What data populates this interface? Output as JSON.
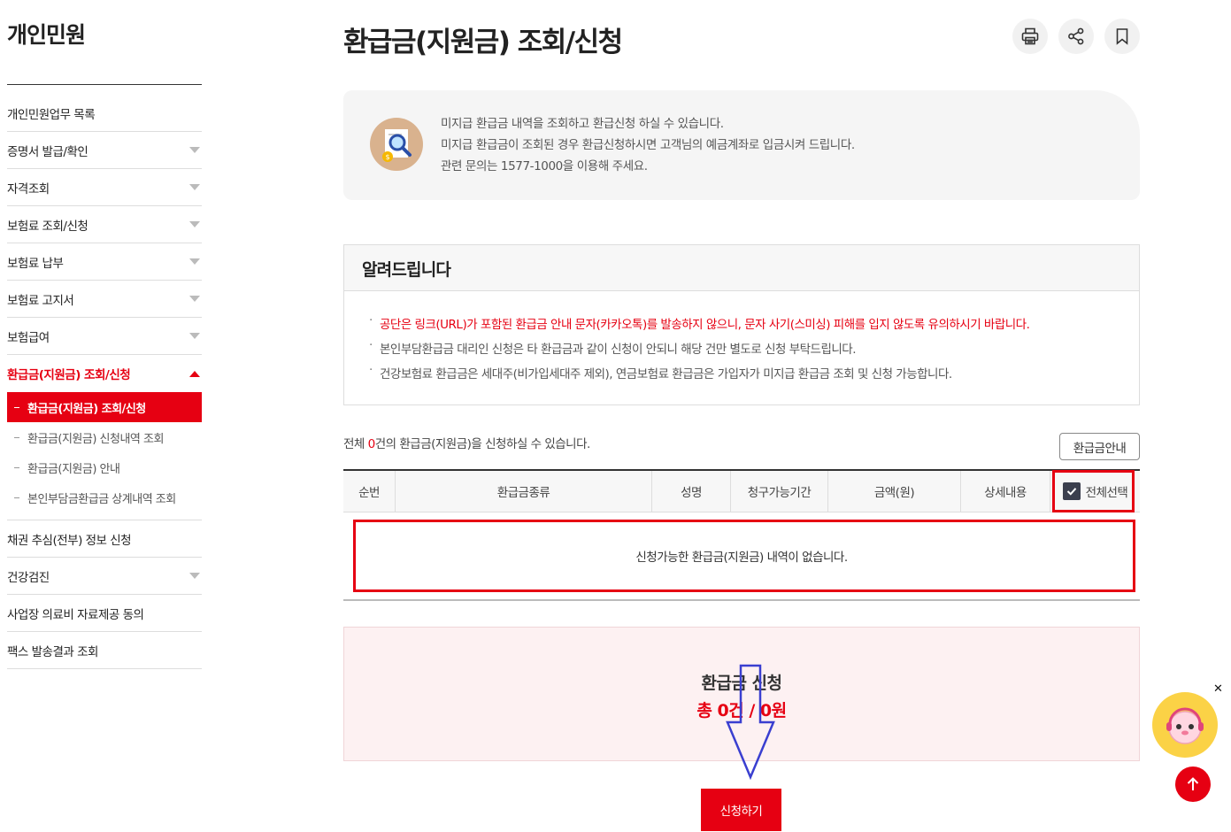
{
  "sidebar": {
    "title": "개인민원",
    "items": [
      {
        "label": "개인민원업무 목록",
        "arrow": false
      },
      {
        "label": "증명서 발급/확인",
        "arrow": true
      },
      {
        "label": "자격조회",
        "arrow": true
      },
      {
        "label": "보험료 조회/신청",
        "arrow": true
      },
      {
        "label": "보험료 납부",
        "arrow": true
      },
      {
        "label": "보험료 고지서",
        "arrow": true
      },
      {
        "label": "보험급여",
        "arrow": true
      },
      {
        "label": "환급금(지원금) 조회/신청",
        "arrow": true,
        "active": true
      },
      {
        "label": "채권 추심(전부) 정보 신청",
        "arrow": false
      },
      {
        "label": "건강검진",
        "arrow": true
      },
      {
        "label": "사업장 의료비 자료제공 동의",
        "arrow": false
      },
      {
        "label": "팩스 발송결과 조회",
        "arrow": false
      }
    ],
    "sub_items": [
      {
        "label": "환급금(지원금) 조회/신청",
        "current": true
      },
      {
        "label": "환급금(지원금) 신청내역 조회"
      },
      {
        "label": "환급금(지원금) 안내"
      },
      {
        "label": "본인부담금환급금 상계내역 조회"
      }
    ]
  },
  "header": {
    "title": "환급금(지원금) 조회/신청",
    "icons": [
      "print-icon",
      "share-icon",
      "bookmark-icon"
    ]
  },
  "info": {
    "lines": [
      "미지급 환급금 내역을 조회하고 환급신청 하실 수 있습니다.",
      "미지급 환급금이 조회된 경우 환급신청하시면 고객님의 예금계좌로 입금시켜 드립니다.",
      "관련 문의는 1577-1000을 이용해 주세요."
    ]
  },
  "notice": {
    "title": "알려드립니다",
    "items": [
      "공단은 링크(URL)가 포함된 환급금 안내 문자(카카오톡)를 발송하지 않으니, 문자 사기(스미싱) 피해를 입지 않도록 유의하시기 바랍니다.",
      "본인부담환급금 대리인 신청은 타 환급금과 같이 신청이 안되니 해당 건만 별도로 신청 부탁드립니다.",
      "건강보험료 환급금은 세대주(비가입세대주 제외), 연금보험료 환급금은 가입자가 미지급 환급금 조회 및 신청 가능합니다."
    ]
  },
  "summary": {
    "prefix": "전체 ",
    "count": "0",
    "suffix": "건의 환급금(지원금)을 신청하실 수 있습니다.",
    "guide_button": "환급금안내"
  },
  "table": {
    "headers": [
      "순번",
      "환급금종류",
      "성명",
      "청구가능기간",
      "금액(원)",
      "상세내용"
    ],
    "select_all_label": "전체선택",
    "select_all_checked": true,
    "empty_message": "신청가능한 환급금(지원금) 내역이 없습니다."
  },
  "apply": {
    "title": "환급금 신청",
    "total": "총 0건 / 0원",
    "submit_label": "신청하기"
  },
  "colors": {
    "accent": "#e60012",
    "checkbox": "#3b3f4e",
    "annotation_arrow": "#3a3fd0"
  }
}
